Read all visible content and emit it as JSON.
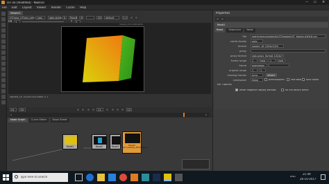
{
  "window": {
    "title": "Ui7.nk [modified] - Nuke10"
  },
  "menubar": {
    "items": [
      "File",
      "Edit",
      "Layout",
      "Viewer",
      "Render",
      "Cache",
      "Help"
    ]
  },
  "viewer": {
    "tab_label": "Viewer1",
    "toolbar": {
      "layer": "UI7pass_UI7pas_cam",
      "channel": "rgba",
      "alpha": "rgba.alpha",
      "input_a": "A",
      "read": "Read1",
      "input_b": "B",
      "b_value": "",
      "zoom": "2D",
      "gain_label": "f/8",
      "gain": "1",
      "gamma_label": "Y",
      "gamma": "1",
      "lut": "default",
      "proxy": "1:1",
      "frame_mode": "2D"
    },
    "format_label": "Square_1K 1024x1024",
    "status": "Square_1K 1024x1024  bbox: 0 1",
    "controls": {
      "fps": "24",
      "frame": "13",
      "frame_end": "1",
      "skip": "10"
    }
  },
  "timeline": {
    "start": "1",
    "end": "1"
  },
  "nodegraph": {
    "tabs": [
      "Node Graph",
      "Curve Editor",
      "Dope Sheet"
    ],
    "nodes": [
      {
        "name": "Read1",
        "caption": "Read1"
      },
      {
        "name": "Read2",
        "caption": "Read2"
      },
      {
        "name": "Read3",
        "caption": "Read3"
      },
      {
        "name": "Read4",
        "caption": "Read4\nUI7_beauty_2021_abcd"
      }
    ]
  },
  "properties": {
    "title": "Properties",
    "node_name": "Read1",
    "tabs": [
      "Read",
      "Sequence",
      "Node"
    ],
    "file_label": "file",
    "file_value": "/pathy/maya/projects/UI7images/UI7_beauty.####.exr",
    "cache_locally_label": "cache locally",
    "cache_locally_value": "auto",
    "format_label": "format",
    "format_value": "square_1K 1024x1024",
    "proxy_label": "proxy",
    "proxy_value": "",
    "proxy_format_label": "proxy format",
    "proxy_format_value": "root.proxy_format 1024x778",
    "frame_range_label": "frame range",
    "frame_range_start": "1",
    "frame_range_mode": "hold",
    "frame_range_end": "1",
    "frame_range_mode2": "hold",
    "frame_label": "frame",
    "frame_value": "expression",
    "original_range_label": "original range",
    "original_range_start": "1",
    "original_range_end": "1",
    "missing_frames_label": "missing frames",
    "missing_frames_value": "error",
    "reload_label": "reload",
    "colorspace_label": "colorspace",
    "colorspace_value": "linear",
    "premultiplied_label": "premultiplied",
    "raw_data_label": "raw data",
    "auto_alpha_label": "auto alpha",
    "exr_options_label": "exr Options",
    "offset_negative_label": "offset negative display window",
    "do_not_attach_label": "do not attach prefix"
  },
  "taskbar": {
    "search_placeholder": "Type here to search",
    "time": "21:49",
    "date": "26-10-2017",
    "lang": "ENG"
  },
  "colors": {
    "accent": "#e07b1f",
    "read_node": "#aaaaaa",
    "selected_node": "#e09a3a",
    "taskbar": "#101820"
  }
}
